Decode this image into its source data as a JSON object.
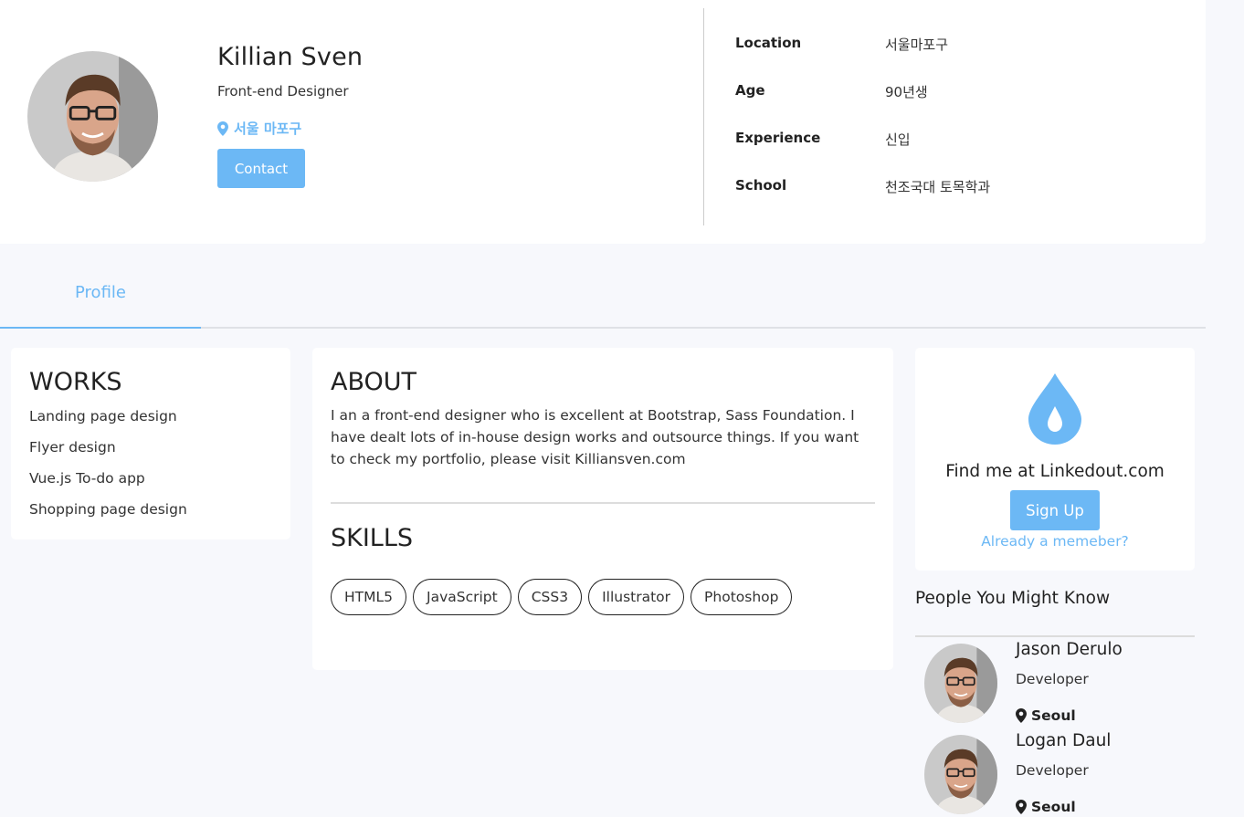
{
  "header": {
    "name": "Killian Sven",
    "role": "Front-end Designer",
    "location": "서울 마포구",
    "contact_label": "Contact",
    "info": [
      {
        "key": "Location",
        "value": "서울마포구"
      },
      {
        "key": "Age",
        "value": "90년생"
      },
      {
        "key": "Experience",
        "value": "신입"
      },
      {
        "key": "School",
        "value": "천조국대 토목학과"
      }
    ]
  },
  "tabs": [
    {
      "label": "Profile",
      "active": true
    }
  ],
  "works": {
    "title": "WORKS",
    "items": [
      "Landing page design",
      "Flyer design",
      "Vue.js To-do app",
      "Shopping page design"
    ]
  },
  "about": {
    "title": "ABOUT",
    "text": "I an a front-end designer who is excellent at Bootstrap, Sass Foundation. I have dealt lots of in-house design works and outsource things. If you want to check my portfolio, please visit Killiansven.com",
    "skills_title": "SKILLS",
    "skills": [
      "HTML5",
      "JavaScript",
      "CSS3",
      "Illustrator",
      "Photoshop"
    ]
  },
  "linkedout": {
    "icon": "water-drop-icon",
    "find_text": "Find me at Linkedout.com",
    "signup_label": "Sign Up",
    "already_label": "Already a memeber?"
  },
  "people": {
    "title": "People You Might Know",
    "items": [
      {
        "name": "Jason Derulo",
        "role": "Developer",
        "location": "Seoul"
      },
      {
        "name": "Logan Daul",
        "role": "Developer",
        "location": "Seoul"
      }
    ]
  },
  "colors": {
    "accent": "#6cb8f5",
    "background": "#f7f8fc"
  }
}
